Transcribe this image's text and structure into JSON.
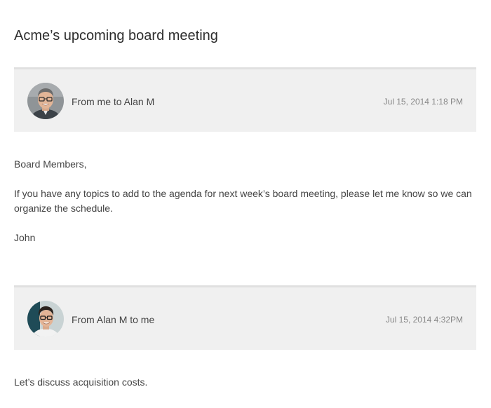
{
  "thread": {
    "subject": "Acme’s upcoming board meeting"
  },
  "messages": [
    {
      "from_line": "From me to Alan M",
      "timestamp": "Jul 15, 2014 1:18 PM",
      "avatar_icon": "avatar-older-man-glasses",
      "body": [
        "Board Members,",
        "If you have any topics to add to the agenda for next week’s board meeting, please let me know so we can organize the schedule.",
        "John"
      ]
    },
    {
      "from_line": "From Alan M to me",
      "timestamp": "Jul 15, 2014 4:32PM",
      "avatar_icon": "avatar-young-man-glasses",
      "body": [
        "Let’s discuss acquisition costs."
      ]
    }
  ],
  "colors": {
    "header_bg": "#f0f0f0",
    "header_border": "#e0e0e0",
    "text": "#444444",
    "muted": "#888888"
  }
}
